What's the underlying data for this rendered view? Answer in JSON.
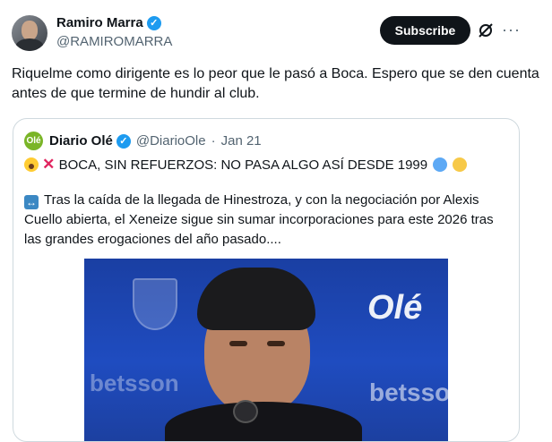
{
  "author": {
    "name": "Ramiro Marra",
    "handle": "@RAMIROMARRA",
    "verified_icon": "verified-badge-icon"
  },
  "actions": {
    "subscribe_label": "Subscribe",
    "grok_icon": "grok-icon",
    "more_icon": "more-icon"
  },
  "tweet": {
    "text": "Riquelme como dirigente es lo peor que le pasó a Boca. Espero que se den cuenta antes de que termine de hundir al club."
  },
  "quote": {
    "avatar_text": "Olé",
    "name": "Diario Olé",
    "handle": "@DiarioOle",
    "separator": "·",
    "date": "Jan 21",
    "headline": "BOCA, SIN REFUERZOS: NO PASA ALGO ASÍ DESDE 1999",
    "body": "Tras la caída de la llegada de Hinestroza, y con la negociación por Alexis Cuello abierta, el Xeneize sigue sin sumar incorporaciones para este 2026 tras las grandes erogaciones del año pasado....",
    "image": {
      "logo_text": "Olé",
      "sponsor_text": "betsson",
      "sponsor_text_left": "betsson"
    }
  },
  "colors": {
    "accent": "#1d9bf0",
    "dot_blue": "#5da9f5",
    "dot_yellow": "#f7c948"
  }
}
